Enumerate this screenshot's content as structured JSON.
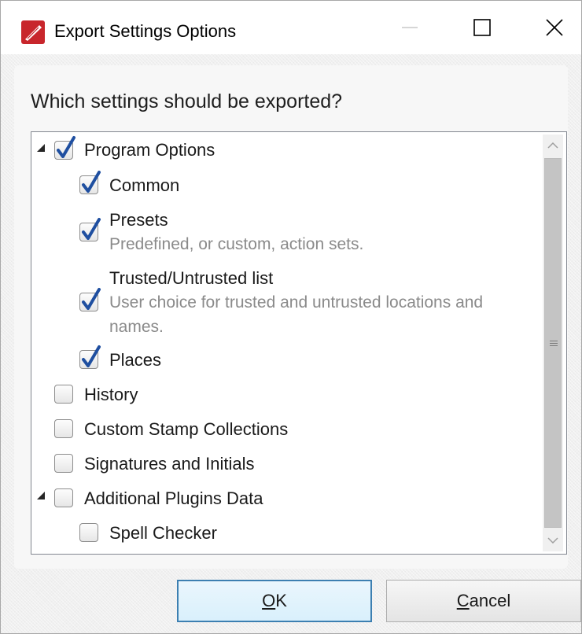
{
  "window": {
    "title": "Export Settings Options",
    "icon": "pdf-feather-app-icon",
    "controls": [
      "minimize",
      "maximize",
      "close"
    ]
  },
  "dialog": {
    "question": "Which settings should be exported?"
  },
  "tree": {
    "items": [
      {
        "label": "Program Options",
        "checked": true,
        "expanded": true,
        "level": 0
      },
      {
        "label": "Common",
        "checked": true,
        "level": 1
      },
      {
        "label": "Presets",
        "description": "Predefined, or custom, action sets.",
        "checked": true,
        "level": 1
      },
      {
        "label": "Trusted/Untrusted list",
        "description_line1": "User choice for trusted and untrusted locations and",
        "description_line2": "names.",
        "checked": true,
        "level": 1
      },
      {
        "label": "Places",
        "checked": true,
        "level": 1
      },
      {
        "label": "History",
        "checked": false,
        "level": 0
      },
      {
        "label": "Custom Stamp Collections",
        "checked": false,
        "level": 0
      },
      {
        "label": "Signatures and Initials",
        "checked": false,
        "level": 0
      },
      {
        "label": "Additional Plugins Data",
        "checked": false,
        "expanded": true,
        "level": 0
      },
      {
        "label": "Spell Checker",
        "checked": false,
        "level": 1
      }
    ]
  },
  "buttons": {
    "ok_mnemonic": "O",
    "ok_rest": "K",
    "cancel_mnemonic": "C",
    "cancel_rest": "ancel"
  },
  "colors": {
    "check": "#1f4fa0",
    "ok_border": "#3c7fb1",
    "app_icon_red": "#c8262c"
  }
}
